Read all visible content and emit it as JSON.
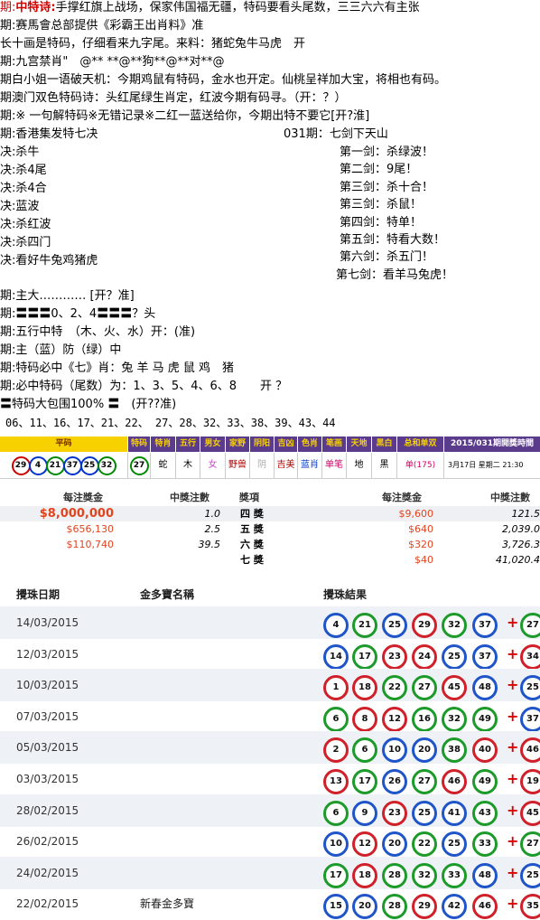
{
  "lines": [
    {
      "pfx": "期:",
      "pfx_red": true,
      "label": "中特诗:",
      "label_red": true,
      "text": "手撑红旗上战场，保家伟国福无疆，特码要看头尾数，三三六六有主张"
    },
    {
      "pfx": "期:",
      "text": "赛馬會总部提供《彩霸王出肖料》准"
    },
    {
      "pfx": "",
      "text": "长十画是特码，仔细看来九字尾。来料：猪蛇兔牛马虎　开"
    },
    {
      "pfx": "期:",
      "text": "九宫禁肖\"　@** **@**狗**@**对**@"
    },
    {
      "pfx": "期",
      "text": "白小姐一语破天机：今期鸡鼠有特码，金水也开定。仙桃呈祥加大宝，将相也有码。"
    },
    {
      "pfx": "期",
      "text": "澳门双色特码诗：头红尾绿生肖定，红波今期有码寻。（开：？）"
    },
    {
      "pfx": "期:",
      "text": "※ 一句解特码※无错记录※二红一蓝送给你，今期出特不要它[开?淮]"
    },
    {
      "pfx": "期:",
      "text": "香港集发特七决"
    }
  ],
  "jue_header_right": "031期：七剑下天山",
  "jue_left": [
    {
      "pfx": "决:",
      "text": "杀牛"
    },
    {
      "pfx": "决:",
      "text": "杀4尾"
    },
    {
      "pfx": "决:",
      "text": "杀4合"
    },
    {
      "pfx": "决:",
      "text": "蓝波"
    },
    {
      "pfx": "决:",
      "text": "杀红波"
    },
    {
      "pfx": "决:",
      "text": "杀四门"
    },
    {
      "pfx": "决:",
      "text": "看好牛兔鸡猪虎"
    }
  ],
  "jian_right": [
    "第一剑：杀绿波！",
    "第二剑：9尾！",
    "第三剑：杀十合！",
    "第三剑：杀鼠！",
    "第四剑：特单！",
    "第五剑：特看大数！",
    "第六剑：杀五门！",
    "第七剑：看羊马兔虎！"
  ],
  "lines2": [
    {
      "pfx": "期:",
      "text": "主大………… [开？准]"
    },
    {
      "pfx": "期:",
      "text": "〓〓〓0、2、4〓〓〓？头"
    },
    {
      "pfx": "期:",
      "text": "五行中特　（木、火、水）开：(准)"
    },
    {
      "pfx": "期:",
      "text": "主（蓝）防（绿）中"
    },
    {
      "pfx": "期:",
      "text": "特码必中《七》肖：兔 羊 马 虎 鼠 鸡　猪"
    },
    {
      "pfx": "期:",
      "text": "必中特码（尾数）为：1、3、5、4、6、8　　开 ？"
    },
    {
      "pfx": "〓",
      "text": "特码大包围100% 〓　(开??准)"
    },
    {
      "pfx": "",
      "text": "06、11、16、17、21、22、 27、28、32、33、38、39、43、44"
    }
  ],
  "resultbar": {
    "headers": [
      "平码",
      "特码",
      "特肖",
      "五行",
      "男女",
      "家野",
      "阴阳",
      "吉凶",
      "色肖",
      "笔画",
      "天地",
      "黑白",
      "总和单双",
      "2015/031期開獎時間"
    ],
    "balls": [
      {
        "n": "29",
        "c": "red"
      },
      {
        "n": "4",
        "c": "blue"
      },
      {
        "n": "21",
        "c": "green"
      },
      {
        "n": "37",
        "c": "blue"
      },
      {
        "n": "25",
        "c": "blue"
      },
      {
        "n": "32",
        "c": "green"
      }
    ],
    "special_ball": {
      "n": "27",
      "c": "green"
    },
    "cells": [
      "蛇",
      "木",
      "女",
      "野兽",
      "阴",
      "吉美",
      "蓝肖",
      "单笔",
      "地",
      "黑",
      "单(175)",
      "3月17日 星期二 21:30"
    ]
  },
  "prizes": {
    "head_left_amount": "每注獎金",
    "head_left_count": "中獎注數",
    "head_item": "獎項",
    "head_right_amount": "每注獎金",
    "head_right_count": "中獎注數",
    "left": [
      {
        "amount": "$8,000,000",
        "count": "1.0"
      },
      {
        "amount": "$656,130",
        "count": "2.5"
      },
      {
        "amount": "$110,740",
        "count": "39.5"
      }
    ],
    "right": [
      {
        "label": "四 獎",
        "amount": "$9,600",
        "count": "121.5"
      },
      {
        "label": "五 獎",
        "amount": "$640",
        "count": "2,039.0"
      },
      {
        "label": "六 獎",
        "amount": "$320",
        "count": "3,726.3"
      },
      {
        "label": "七 獎",
        "amount": "$40",
        "count": "41,020.4"
      }
    ]
  },
  "history": {
    "head_date": "攪珠日期",
    "head_name": "金多寶名稱",
    "head_result": "攪珠結果",
    "rows": [
      {
        "date": "14/03/2015",
        "name": "",
        "balls": [
          [
            "4",
            "blue"
          ],
          [
            "21",
            "green"
          ],
          [
            "25",
            "blue"
          ],
          [
            "29",
            "red"
          ],
          [
            "32",
            "green"
          ],
          [
            "37",
            "blue"
          ]
        ],
        "extra": [
          "27",
          "green"
        ]
      },
      {
        "date": "12/03/2015",
        "name": "",
        "balls": [
          [
            "14",
            "blue"
          ],
          [
            "17",
            "green"
          ],
          [
            "23",
            "red"
          ],
          [
            "24",
            "red"
          ],
          [
            "25",
            "blue"
          ],
          [
            "37",
            "blue"
          ]
        ],
        "extra": [
          "34",
          "red"
        ]
      },
      {
        "date": "10/03/2015",
        "name": "",
        "balls": [
          [
            "1",
            "red"
          ],
          [
            "18",
            "red"
          ],
          [
            "22",
            "green"
          ],
          [
            "27",
            "green"
          ],
          [
            "45",
            "red"
          ],
          [
            "48",
            "blue"
          ]
        ],
        "extra": [
          "25",
          "blue"
        ]
      },
      {
        "date": "07/03/2015",
        "name": "",
        "balls": [
          [
            "6",
            "green"
          ],
          [
            "8",
            "red"
          ],
          [
            "12",
            "red"
          ],
          [
            "16",
            "green"
          ],
          [
            "32",
            "green"
          ],
          [
            "49",
            "green"
          ]
        ],
        "extra": [
          "37",
          "blue"
        ]
      },
      {
        "date": "05/03/2015",
        "name": "",
        "balls": [
          [
            "2",
            "red"
          ],
          [
            "6",
            "green"
          ],
          [
            "10",
            "blue"
          ],
          [
            "20",
            "blue"
          ],
          [
            "38",
            "green"
          ],
          [
            "40",
            "red"
          ]
        ],
        "extra": [
          "46",
          "red"
        ]
      },
      {
        "date": "03/03/2015",
        "name": "",
        "balls": [
          [
            "13",
            "red"
          ],
          [
            "17",
            "green"
          ],
          [
            "26",
            "blue"
          ],
          [
            "27",
            "green"
          ],
          [
            "46",
            "red"
          ],
          [
            "49",
            "green"
          ]
        ],
        "extra": [
          "19",
          "red"
        ]
      },
      {
        "date": "28/02/2015",
        "name": "",
        "balls": [
          [
            "6",
            "green"
          ],
          [
            "9",
            "blue"
          ],
          [
            "23",
            "red"
          ],
          [
            "25",
            "blue"
          ],
          [
            "41",
            "blue"
          ],
          [
            "43",
            "green"
          ]
        ],
        "extra": [
          "45",
          "red"
        ]
      },
      {
        "date": "26/02/2015",
        "name": "",
        "balls": [
          [
            "10",
            "blue"
          ],
          [
            "12",
            "red"
          ],
          [
            "20",
            "blue"
          ],
          [
            "22",
            "green"
          ],
          [
            "25",
            "blue"
          ],
          [
            "33",
            "green"
          ]
        ],
        "extra": [
          "27",
          "green"
        ]
      },
      {
        "date": "24/02/2015",
        "name": "",
        "balls": [
          [
            "17",
            "green"
          ],
          [
            "18",
            "red"
          ],
          [
            "28",
            "green"
          ],
          [
            "32",
            "green"
          ],
          [
            "33",
            "green"
          ],
          [
            "48",
            "blue"
          ]
        ],
        "extra": [
          "25",
          "blue"
        ]
      },
      {
        "date": "22/02/2015",
        "name": "新春金多寶",
        "balls": [
          [
            "15",
            "blue"
          ],
          [
            "20",
            "blue"
          ],
          [
            "28",
            "green"
          ],
          [
            "29",
            "red"
          ],
          [
            "42",
            "blue"
          ],
          [
            "46",
            "red"
          ]
        ],
        "extra": [
          "35",
          "red"
        ]
      }
    ]
  },
  "colors": {
    "red": "#d00000",
    "header_purple": "#5b3b8c",
    "header_yellow": "#f7d100"
  }
}
